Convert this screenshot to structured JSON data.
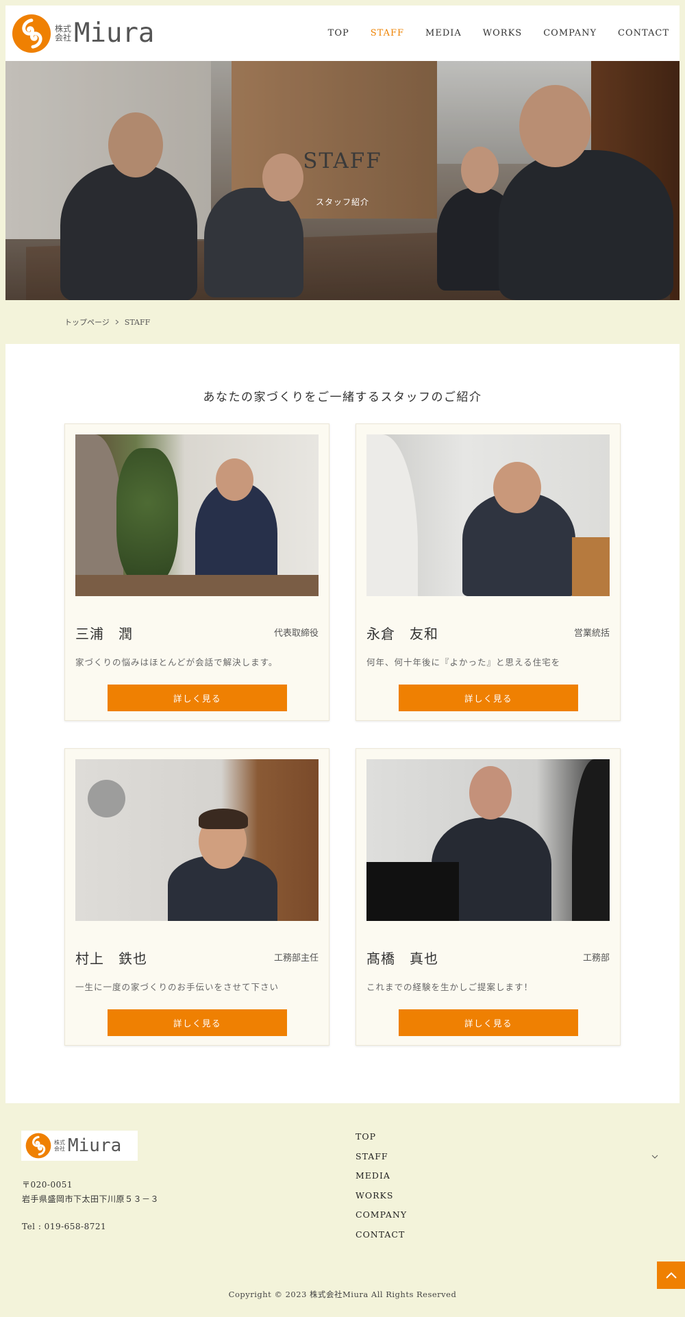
{
  "brand": {
    "kaisha_top": "株式",
    "kaisha_bottom": "会社",
    "name": "Miura",
    "accent": "#ef8002",
    "bg": "#f3f3da"
  },
  "nav": {
    "items": [
      "TOP",
      "STAFF",
      "MEDIA",
      "WORKS",
      "COMPANY",
      "CONTACT"
    ],
    "active": "STAFF"
  },
  "hero": {
    "title": "STAFF",
    "subtitle": "スタッフ紹介"
  },
  "breadcrumb": {
    "home": "トップページ",
    "current": "STAFF"
  },
  "lead": "あなたの家づくりをご一緒するスタッフのご紹介",
  "staff": [
    {
      "name": "三浦　潤",
      "role": "代表取締役",
      "message": "家づくりの悩みはほとんどが会話で解決します。",
      "button": "詳しく見る"
    },
    {
      "name": "永倉　友和",
      "role": "営業統括",
      "message": "何年、何十年後に『よかった』と思える住宅を",
      "button": "詳しく見る"
    },
    {
      "name": "村上　鉄也",
      "role": "工務部主任",
      "message": "一生に一度の家づくりのお手伝いをさせて下さい",
      "button": "詳しく見る"
    },
    {
      "name": "髙橋　真也",
      "role": "工務部",
      "message": "これまでの経験を生かしご提案します！",
      "button": "詳しく見る"
    }
  ],
  "footer": {
    "postal": "〒020-0051",
    "address": "岩手県盛岡市下太田下川原５３－３",
    "tel": "Tel : 019-658-8721",
    "nav": [
      "TOP",
      "STAFF",
      "MEDIA",
      "WORKS",
      "COMPANY",
      "CONTACT"
    ],
    "copyright": "Copyright © 2023 株式会社Miura All Rights Reserved"
  }
}
